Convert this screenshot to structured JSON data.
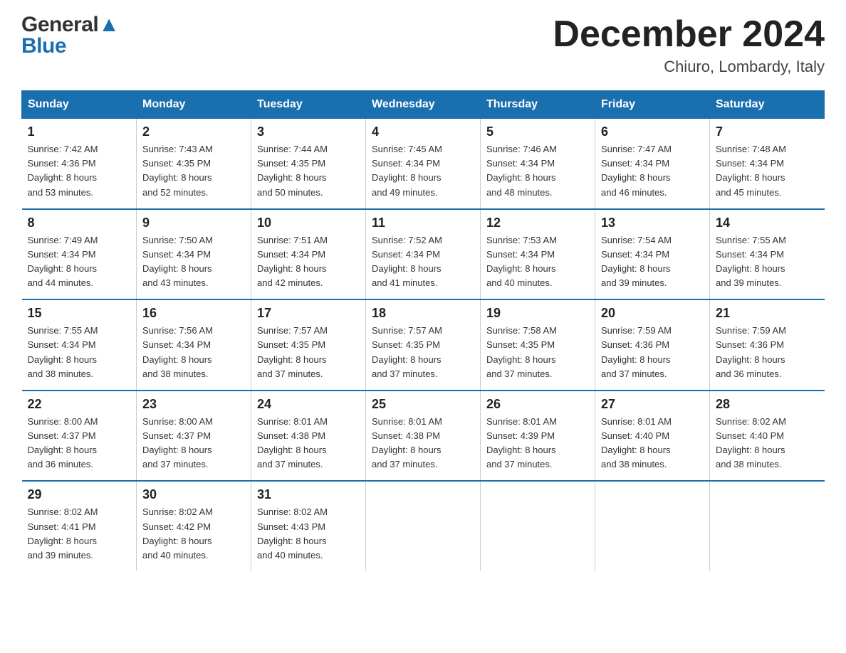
{
  "header": {
    "title": "December 2024",
    "subtitle": "Chiuro, Lombardy, Italy",
    "logo_general": "General",
    "logo_blue": "Blue"
  },
  "calendar": {
    "days_of_week": [
      "Sunday",
      "Monday",
      "Tuesday",
      "Wednesday",
      "Thursday",
      "Friday",
      "Saturday"
    ],
    "weeks": [
      [
        {
          "day": "1",
          "sunrise": "7:42 AM",
          "sunset": "4:36 PM",
          "daylight": "8 hours and 53 minutes."
        },
        {
          "day": "2",
          "sunrise": "7:43 AM",
          "sunset": "4:35 PM",
          "daylight": "8 hours and 52 minutes."
        },
        {
          "day": "3",
          "sunrise": "7:44 AM",
          "sunset": "4:35 PM",
          "daylight": "8 hours and 50 minutes."
        },
        {
          "day": "4",
          "sunrise": "7:45 AM",
          "sunset": "4:34 PM",
          "daylight": "8 hours and 49 minutes."
        },
        {
          "day": "5",
          "sunrise": "7:46 AM",
          "sunset": "4:34 PM",
          "daylight": "8 hours and 48 minutes."
        },
        {
          "day": "6",
          "sunrise": "7:47 AM",
          "sunset": "4:34 PM",
          "daylight": "8 hours and 46 minutes."
        },
        {
          "day": "7",
          "sunrise": "7:48 AM",
          "sunset": "4:34 PM",
          "daylight": "8 hours and 45 minutes."
        }
      ],
      [
        {
          "day": "8",
          "sunrise": "7:49 AM",
          "sunset": "4:34 PM",
          "daylight": "8 hours and 44 minutes."
        },
        {
          "day": "9",
          "sunrise": "7:50 AM",
          "sunset": "4:34 PM",
          "daylight": "8 hours and 43 minutes."
        },
        {
          "day": "10",
          "sunrise": "7:51 AM",
          "sunset": "4:34 PM",
          "daylight": "8 hours and 42 minutes."
        },
        {
          "day": "11",
          "sunrise": "7:52 AM",
          "sunset": "4:34 PM",
          "daylight": "8 hours and 41 minutes."
        },
        {
          "day": "12",
          "sunrise": "7:53 AM",
          "sunset": "4:34 PM",
          "daylight": "8 hours and 40 minutes."
        },
        {
          "day": "13",
          "sunrise": "7:54 AM",
          "sunset": "4:34 PM",
          "daylight": "8 hours and 39 minutes."
        },
        {
          "day": "14",
          "sunrise": "7:55 AM",
          "sunset": "4:34 PM",
          "daylight": "8 hours and 39 minutes."
        }
      ],
      [
        {
          "day": "15",
          "sunrise": "7:55 AM",
          "sunset": "4:34 PM",
          "daylight": "8 hours and 38 minutes."
        },
        {
          "day": "16",
          "sunrise": "7:56 AM",
          "sunset": "4:34 PM",
          "daylight": "8 hours and 38 minutes."
        },
        {
          "day": "17",
          "sunrise": "7:57 AM",
          "sunset": "4:35 PM",
          "daylight": "8 hours and 37 minutes."
        },
        {
          "day": "18",
          "sunrise": "7:57 AM",
          "sunset": "4:35 PM",
          "daylight": "8 hours and 37 minutes."
        },
        {
          "day": "19",
          "sunrise": "7:58 AM",
          "sunset": "4:35 PM",
          "daylight": "8 hours and 37 minutes."
        },
        {
          "day": "20",
          "sunrise": "7:59 AM",
          "sunset": "4:36 PM",
          "daylight": "8 hours and 37 minutes."
        },
        {
          "day": "21",
          "sunrise": "7:59 AM",
          "sunset": "4:36 PM",
          "daylight": "8 hours and 36 minutes."
        }
      ],
      [
        {
          "day": "22",
          "sunrise": "8:00 AM",
          "sunset": "4:37 PM",
          "daylight": "8 hours and 36 minutes."
        },
        {
          "day": "23",
          "sunrise": "8:00 AM",
          "sunset": "4:37 PM",
          "daylight": "8 hours and 37 minutes."
        },
        {
          "day": "24",
          "sunrise": "8:01 AM",
          "sunset": "4:38 PM",
          "daylight": "8 hours and 37 minutes."
        },
        {
          "day": "25",
          "sunrise": "8:01 AM",
          "sunset": "4:38 PM",
          "daylight": "8 hours and 37 minutes."
        },
        {
          "day": "26",
          "sunrise": "8:01 AM",
          "sunset": "4:39 PM",
          "daylight": "8 hours and 37 minutes."
        },
        {
          "day": "27",
          "sunrise": "8:01 AM",
          "sunset": "4:40 PM",
          "daylight": "8 hours and 38 minutes."
        },
        {
          "day": "28",
          "sunrise": "8:02 AM",
          "sunset": "4:40 PM",
          "daylight": "8 hours and 38 minutes."
        }
      ],
      [
        {
          "day": "29",
          "sunrise": "8:02 AM",
          "sunset": "4:41 PM",
          "daylight": "8 hours and 39 minutes."
        },
        {
          "day": "30",
          "sunrise": "8:02 AM",
          "sunset": "4:42 PM",
          "daylight": "8 hours and 40 minutes."
        },
        {
          "day": "31",
          "sunrise": "8:02 AM",
          "sunset": "4:43 PM",
          "daylight": "8 hours and 40 minutes."
        },
        null,
        null,
        null,
        null
      ]
    ]
  }
}
